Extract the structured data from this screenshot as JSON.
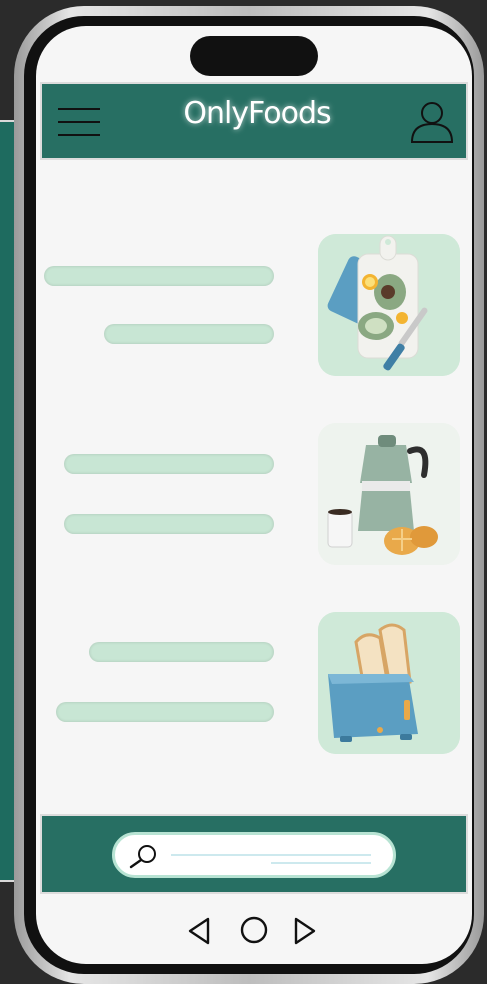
{
  "app": {
    "brand": "OnlyFoods",
    "accent_color": "#276f63",
    "placeholder_bar_color": "#c8e6d4"
  },
  "header": {
    "menu_icon": "hamburger-menu-icon",
    "profile_icon": "user-icon"
  },
  "feed": {
    "items": [
      {
        "image": "cutting-board-avocado-illustration"
      },
      {
        "image": "moka-pot-coffee-illustration"
      },
      {
        "image": "toaster-bread-illustration"
      }
    ]
  },
  "footer": {
    "search_icon": "search-icon",
    "search_placeholder": ""
  },
  "navigation": {
    "back_icon": "back-triangle-icon",
    "home_icon": "home-circle-icon",
    "recent_icon": "forward-triangle-icon"
  }
}
